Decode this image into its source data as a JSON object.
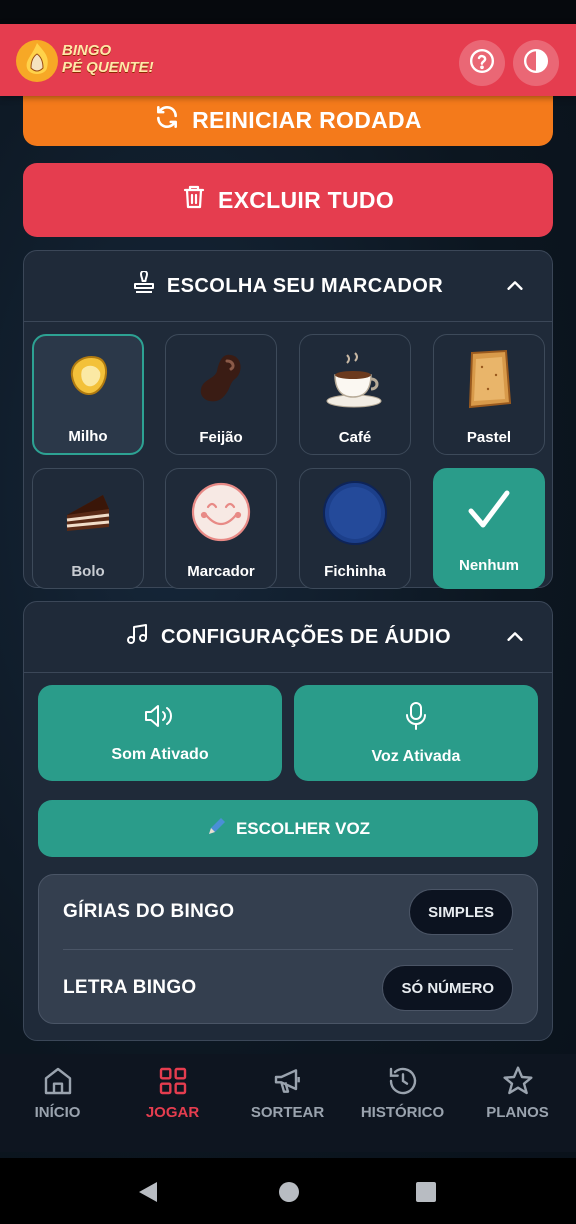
{
  "app": {
    "logo_line1": "BINGO",
    "logo_line2": "PÉ QUENTE!",
    "brand_color": "#e53d4f",
    "accent_color": "#2a9c8a",
    "orange_color": "#f47a1b"
  },
  "header": {
    "help_icon": "question-circle-icon",
    "power_icon": "power-icon"
  },
  "actions": {
    "restart_label": "REINICIAR RODADA",
    "delete_label": "EXCLUIR TUDO"
  },
  "marker_panel": {
    "title": "ESCOLHA SEU MARCADOR",
    "items": [
      {
        "label": "Milho",
        "icon": "corn-icon",
        "selected": true
      },
      {
        "label": "Feijão",
        "icon": "bean-icon",
        "selected": false
      },
      {
        "label": "Café",
        "icon": "coffee-cup-icon",
        "selected": false
      },
      {
        "label": "Pastel",
        "icon": "pastry-icon",
        "selected": false
      },
      {
        "label": "Bolo",
        "icon": "cake-slice-icon",
        "selected": false
      },
      {
        "label": "Marcador",
        "icon": "smiley-stamp-icon",
        "selected": false
      },
      {
        "label": "Fichinha",
        "icon": "blue-chip-icon",
        "selected": false
      },
      {
        "label": "Nenhum",
        "icon": "checkmark-icon",
        "selected": false
      }
    ]
  },
  "audio_panel": {
    "title": "CONFIGURAÇÕES DE ÁUDIO",
    "sound_label": "Som Ativado",
    "voice_label": "Voz Ativada",
    "choose_voice_label": "ESCOLHER VOZ",
    "slang_label": "GÍRIAS DO BINGO",
    "slang_value": "SIMPLES",
    "letter_label": "LETRA BINGO",
    "letter_value": "SÓ NÚMERO"
  },
  "nav": {
    "items": [
      {
        "label": "INÍCIO",
        "icon": "home-icon"
      },
      {
        "label": "JOGAR",
        "icon": "grid-icon",
        "active": true
      },
      {
        "label": "SORTEAR",
        "icon": "megaphone-icon"
      },
      {
        "label": "HISTÓRICO",
        "icon": "history-icon"
      },
      {
        "label": "PLANOS",
        "icon": "star-icon"
      }
    ]
  }
}
